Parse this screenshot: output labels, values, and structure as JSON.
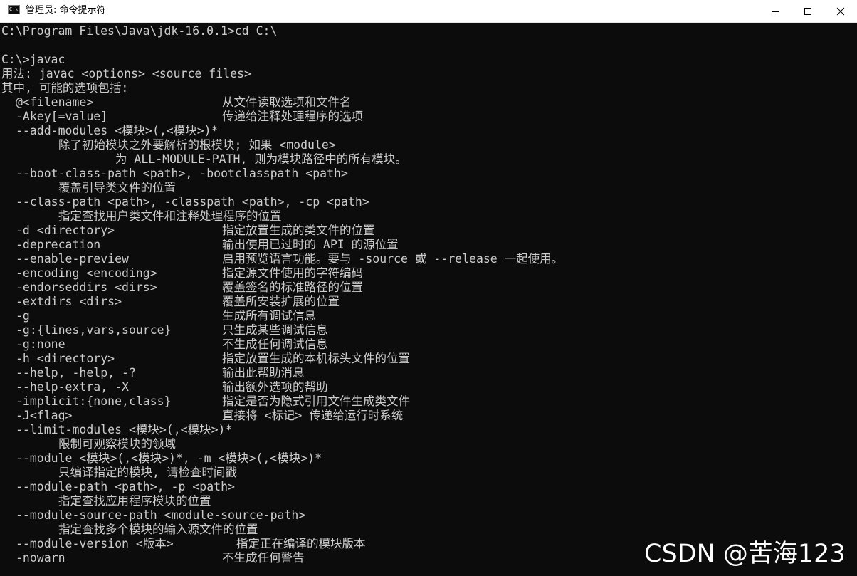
{
  "window": {
    "title": "管理员: 命令提示符",
    "icon_label": "C:\\."
  },
  "console": {
    "lines": [
      {
        "text": "C:\\Program Files\\Java\\jdk-16.0.1>cd C:\\"
      },
      {
        "text": ""
      },
      {
        "text": "C:\\>javac"
      },
      {
        "text": "用法: javac <options> <source files>"
      },
      {
        "text": "其中, 可能的选项包括:"
      },
      {
        "option": "@<filename>",
        "desc": "从文件读取选项和文件名"
      },
      {
        "option": "-Akey[=value]",
        "desc": "传递给注释处理程序的选项"
      },
      {
        "option": "--add-modules <模块>(,<模块>)*"
      },
      {
        "cont": "除了初始模块之外要解析的根模块; 如果 <module>"
      },
      {
        "cont2": "为 ALL-MODULE-PATH, 则为模块路径中的所有模块。"
      },
      {
        "option": "--boot-class-path <path>, -bootclasspath <path>"
      },
      {
        "cont": "覆盖引导类文件的位置"
      },
      {
        "option": "--class-path <path>, -classpath <path>, -cp <path>"
      },
      {
        "cont": "指定查找用户类文件和注释处理程序的位置"
      },
      {
        "option": "-d <directory>",
        "desc": "指定放置生成的类文件的位置"
      },
      {
        "option": "-deprecation",
        "desc": "输出使用已过时的 API 的源位置"
      },
      {
        "option": "--enable-preview",
        "desc": "启用预览语言功能。要与 -source 或 --release 一起使用。"
      },
      {
        "option": "-encoding <encoding>",
        "desc": "指定源文件使用的字符编码"
      },
      {
        "option": "-endorseddirs <dirs>",
        "desc": "覆盖签名的标准路径的位置"
      },
      {
        "option": "-extdirs <dirs>",
        "desc": "覆盖所安装扩展的位置"
      },
      {
        "option": "-g",
        "desc": "生成所有调试信息"
      },
      {
        "option": "-g:{lines,vars,source}",
        "desc": "只生成某些调试信息"
      },
      {
        "option": "-g:none",
        "desc": "不生成任何调试信息"
      },
      {
        "option": "-h <directory>",
        "desc": "指定放置生成的本机标头文件的位置"
      },
      {
        "option": "--help, -help, -?",
        "desc": "输出此帮助消息"
      },
      {
        "option": "--help-extra, -X",
        "desc": "输出额外选项的帮助"
      },
      {
        "option": "-implicit:{none,class}",
        "desc": "指定是否为隐式引用文件生成类文件"
      },
      {
        "option": "-J<flag>",
        "desc": "直接将 <标记> 传递给运行时系统"
      },
      {
        "option": "--limit-modules <模块>(,<模块>)*"
      },
      {
        "cont": "限制可观察模块的领域"
      },
      {
        "option": "--module <模块>(,<模块>)*, -m <模块>(,<模块>)*"
      },
      {
        "cont": "只编译指定的模块, 请检查时间戳"
      },
      {
        "option": "--module-path <path>, -p <path>"
      },
      {
        "cont": "指定查找应用程序模块的位置"
      },
      {
        "option": "--module-source-path <module-source-path>"
      },
      {
        "cont": "指定查找多个模块的输入源文件的位置"
      },
      {
        "option": "--module-version <版本>",
        "desc_wide": "指定正在编译的模块版本"
      },
      {
        "option": "-nowarn",
        "desc": "不生成任何警告"
      }
    ]
  },
  "watermark": {
    "text": "CSDN @苦海123"
  },
  "colors": {
    "console_background": "#0c0c0c",
    "console_text": "#cccccc",
    "titlebar_background": "#ffffff"
  }
}
